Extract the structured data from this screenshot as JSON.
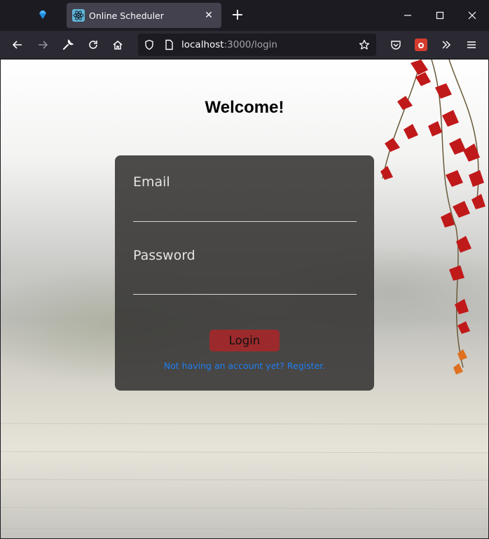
{
  "browser": {
    "tab": {
      "title": "Online Scheduler",
      "close_glyph": "✕"
    },
    "new_tab_glyph": "+",
    "url": {
      "host": "localhost",
      "rest": ":3000/login"
    },
    "icons": {
      "pinned_tab": "gem-icon",
      "tab_favicon": "react-atom-icon",
      "back": "back-arrow-icon",
      "forward": "forward-arrow-icon",
      "tools": "wrench-icon",
      "reload": "reload-icon",
      "home": "home-icon",
      "tracking": "shield-icon",
      "page_info": "page-icon",
      "bookmark": "star-icon",
      "pocket": "pocket-icon",
      "extension": "extension-icon",
      "overflow": "chevron-double-right-icon",
      "menu": "hamburger-menu-icon"
    }
  },
  "page": {
    "title": "Welcome!",
    "email_label": "Email",
    "email_value": "",
    "password_label": "Password",
    "password_value": "",
    "login_label": "Login",
    "register_link": "Not having an account yet? Register."
  },
  "colors": {
    "login_button": "#9c2a2c",
    "link": "#1f7ef0",
    "card": "#343332"
  }
}
